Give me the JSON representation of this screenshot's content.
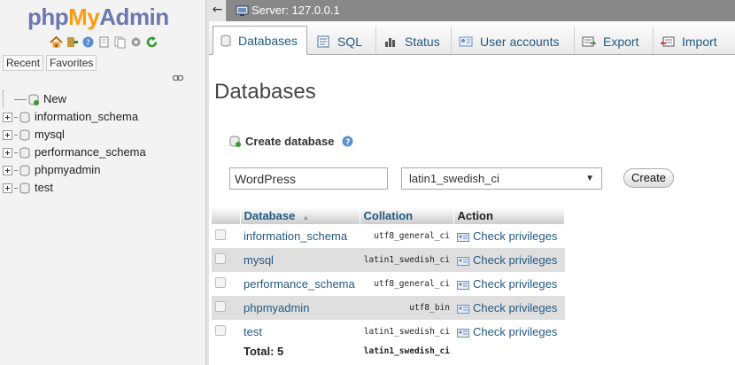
{
  "logo": {
    "php": "php",
    "my": "My",
    "admin": "Admin"
  },
  "nav": {
    "tabs": [
      "Recent",
      "Favorites"
    ],
    "tree": [
      {
        "label": "New"
      },
      {
        "label": "information_schema"
      },
      {
        "label": "mysql"
      },
      {
        "label": "performance_schema"
      },
      {
        "label": "phpmyadmin"
      },
      {
        "label": "test"
      }
    ]
  },
  "topbar": {
    "back": "←",
    "server": "Server: 127.0.0.1"
  },
  "menu": {
    "tabs": [
      "Databases",
      "SQL",
      "Status",
      "User accounts",
      "Export",
      "Import"
    ]
  },
  "main": {
    "title": "Databases",
    "create_heading": "Create database",
    "db_name_value": "WordPress",
    "collation_value": "latin1_swedish_ci",
    "create_button": "Create"
  },
  "table": {
    "headers": {
      "database": "Database",
      "collation": "Collation",
      "action": "Action"
    },
    "rows": [
      {
        "name": "information_schema",
        "collation": "utf8_general_ci",
        "action": "Check privileges"
      },
      {
        "name": "mysql",
        "collation": "latin1_swedish_ci",
        "action": "Check privileges"
      },
      {
        "name": "performance_schema",
        "collation": "utf8_general_ci",
        "action": "Check privileges"
      },
      {
        "name": "phpmyadmin",
        "collation": "utf8_bin",
        "action": "Check privileges"
      },
      {
        "name": "test",
        "collation": "latin1_swedish_ci",
        "action": "Check privileges"
      }
    ],
    "total_label": "Total: 5",
    "total_collation": "latin1_swedish_ci"
  },
  "colors": {
    "link": "#235a81",
    "topbar": "#888888",
    "logo_blue": "#6c78af",
    "logo_orange": "#f89c0e"
  }
}
